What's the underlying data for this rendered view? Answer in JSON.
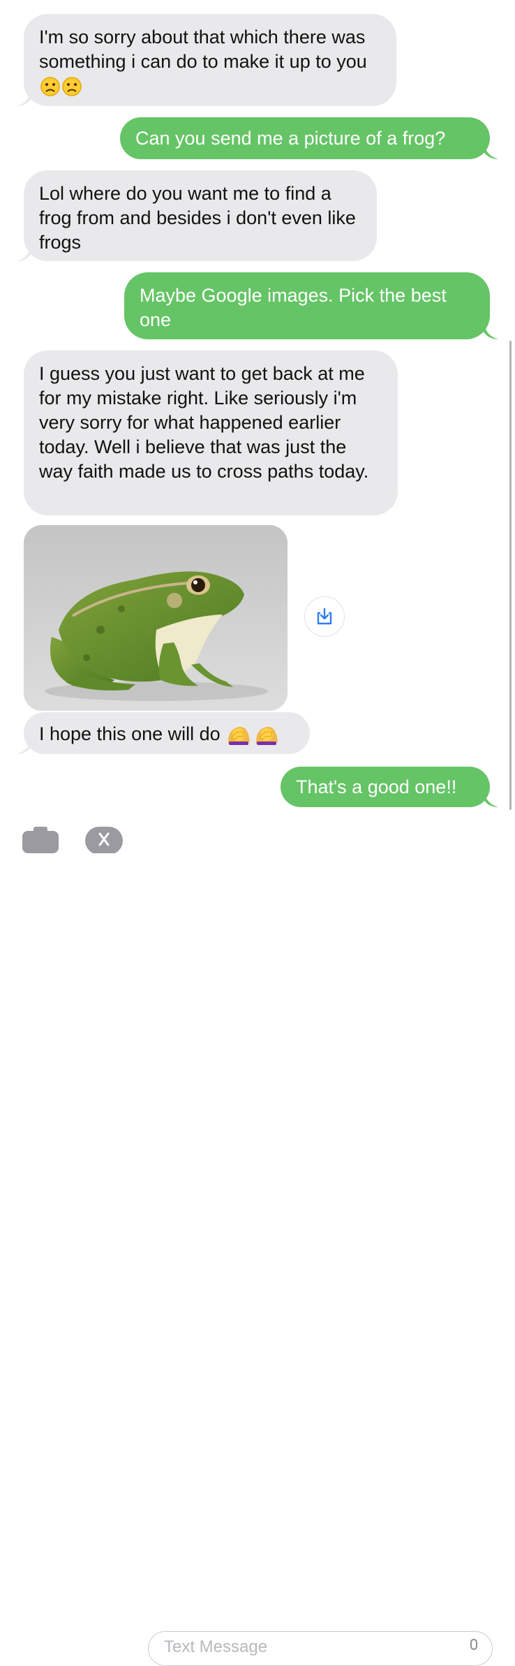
{
  "messages": [
    {
      "direction": "incoming",
      "text": "I'm so sorry about that which there was something i can do to make it up to you",
      "emoji": "😟😟"
    },
    {
      "direction": "outgoing",
      "text": "Can you send me a picture of a frog?"
    },
    {
      "direction": "incoming",
      "text": "Lol where do you want me to find a frog from and besides i don't even like frogs"
    },
    {
      "direction": "outgoing",
      "text": "Maybe Google images. Pick the best one"
    },
    {
      "direction": "incoming",
      "text": "I guess you just want to get back at me for my mistake right. Like seriously i'm very sorry for what happened earlier today. Well i believe that was just the way faith made us to cross paths today."
    },
    {
      "direction": "incoming",
      "type": "image",
      "image_subject": "frog-photo",
      "action_icon": "download-icon"
    },
    {
      "direction": "incoming",
      "text": "I hope this one will do",
      "emoji": "🤦‍♀️🤦‍♀️"
    },
    {
      "direction": "outgoing",
      "text": "That's a good one!!"
    }
  ],
  "composer": {
    "placeholder": "Text Message",
    "icons": [
      "camera-icon",
      "app-store-icon",
      "microphone-icon"
    ]
  },
  "colors": {
    "incoming_bubble": "#e9e9eb",
    "outgoing_bubble": "#65c466",
    "outgoing_text": "#ffffff",
    "download_accent": "#2f7cf6"
  }
}
